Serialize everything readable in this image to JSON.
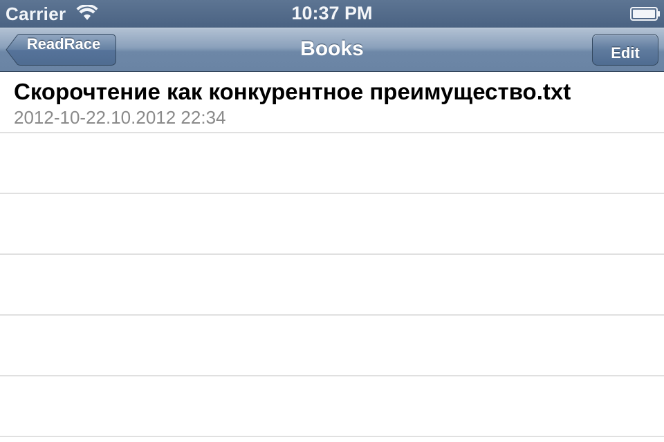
{
  "status_bar": {
    "carrier": "Carrier",
    "time": "10:37 PM",
    "wifi_icon": "wifi-icon",
    "battery_icon": "battery-icon"
  },
  "nav_bar": {
    "title": "Books",
    "back_label": "ReadRace",
    "edit_label": "Edit"
  },
  "books": [
    {
      "title": "Скорочтение как конкурентное преимущество.txt",
      "subtitle": "2012-10-22.10.2012 22:34"
    }
  ],
  "colors": {
    "nav_bar": "#7089a8",
    "status_bar": "#546c8b",
    "subtitle_text": "#8a8a8a",
    "separator": "#e0e0e0"
  }
}
